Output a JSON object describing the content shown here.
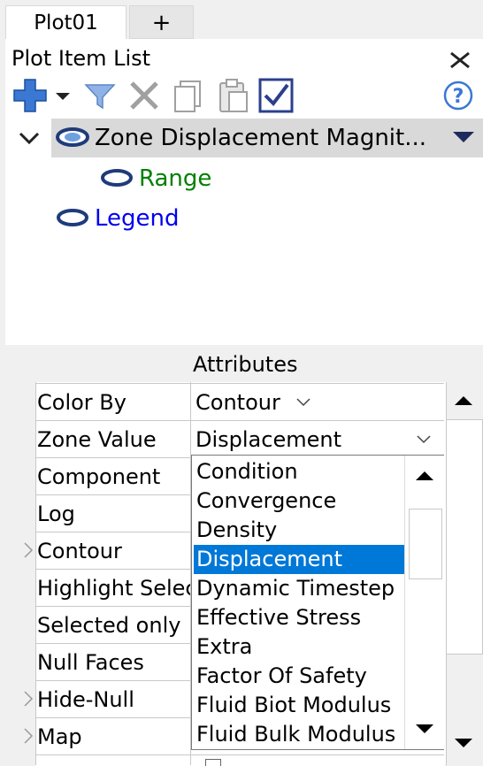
{
  "tabs": {
    "active": "Plot01",
    "add": "+"
  },
  "panel": {
    "title": "Plot Item List"
  },
  "tree": {
    "selected": "Zone Displacement Magnit...",
    "child": "Range",
    "legend": "Legend"
  },
  "attributes": {
    "header": "Attributes",
    "rows": [
      {
        "label": "Color By",
        "value": "Contour"
      },
      {
        "label": "Zone Value",
        "value": "Displacement"
      },
      {
        "label": "Component",
        "value": ""
      },
      {
        "label": "Log",
        "value": ""
      },
      {
        "label": "Contour",
        "value": ""
      },
      {
        "label": "Highlight Selec",
        "value": ""
      },
      {
        "label": "Selected only",
        "value": ""
      },
      {
        "label": "Null Faces",
        "value": ""
      },
      {
        "label": "Hide-Null",
        "value": ""
      },
      {
        "label": "Map",
        "value": ""
      }
    ]
  },
  "dropdown": {
    "options": [
      "Condition",
      "Convergence",
      "Density",
      "Displacement",
      "Dynamic Timestep",
      "Effective Stress",
      "Extra",
      "Factor Of Safety",
      "Fluid Biot Modulus",
      "Fluid Bulk Modulus"
    ],
    "selected": "Displacement"
  },
  "colors": {
    "selection": "#0078d7",
    "green_text": "#008000",
    "blue_text": "#0000ee"
  }
}
